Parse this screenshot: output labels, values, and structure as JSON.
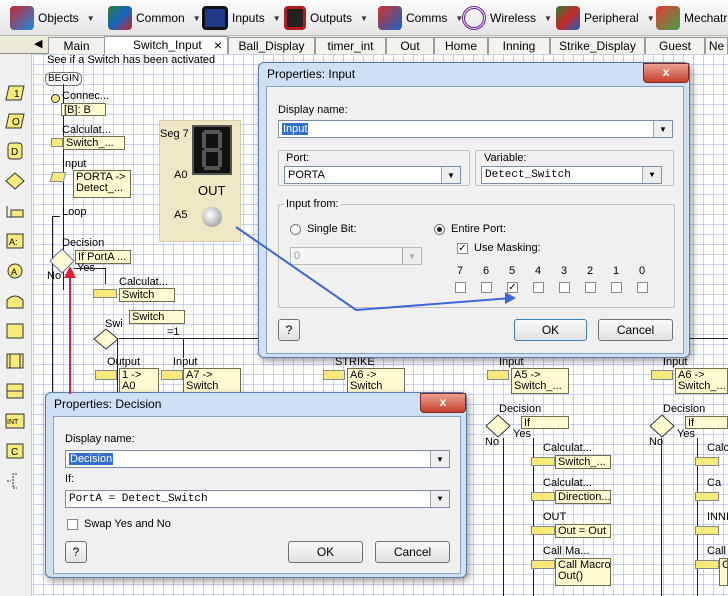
{
  "toolbar": {
    "items": [
      {
        "label": "Objects"
      },
      {
        "label": "Common"
      },
      {
        "label": "Inputs"
      },
      {
        "label": "Outputs"
      },
      {
        "label": "Comms"
      },
      {
        "label": "Wireless"
      },
      {
        "label": "Peripheral"
      },
      {
        "label": "Mechatr"
      }
    ]
  },
  "tabs": [
    "Main",
    "Switch_Input",
    "Ball_Display",
    "timer_int",
    "Out",
    "Home",
    "Inning",
    "Strike_Display",
    "Guest",
    "Ne"
  ],
  "tabs_close": "×",
  "canvas": {
    "comment": "See if a Switch has been activated",
    "begin": "BEGIN",
    "connection_label": "Connec...",
    "connection_box": "[B]: B",
    "calc1_label": "Calculat...",
    "calc1_box": "Switch_...",
    "input_label": "Input",
    "input_box": "PORTA ->\nDetect_...",
    "loop_label": "Loop",
    "decision_label": "Decision",
    "decision_box": "If PortA ...",
    "yes": "Yes",
    "no": "No",
    "calc2_label": "Calculat...",
    "calc2_box": "Switch =...",
    "switch_label": "Swi",
    "switch_box": "Switch S...",
    "switch_value": "=1",
    "output_label": "Output",
    "output_box": "1 -> A0",
    "input2_label": "Input",
    "input2_box": "A7 ->\nSwitch",
    "strike_label": "STRIKE",
    "strike_box": "A6 ->\nSwitch",
    "input3_label": "Input",
    "input3_box": "A5 ->\nSwitch_...",
    "input4_label": "Input",
    "input4_box": "A6 ->\nSwitch_...",
    "decision2_label": "Decision",
    "decision2_box": "If Switc...",
    "decision3_label": "Decision",
    "decision3_box": "If Switc...",
    "calc3_label": "Calculat...",
    "calc3_box": "Switch_...",
    "calc4_label": "Calculat...",
    "calc4_box": "Direction...",
    "out_label": "OUT",
    "out_box": "Out = Out",
    "callmacro_label": "Call Ma...",
    "callmacro_box": "Call Macro\nOut()",
    "calc5_label": "Calc",
    "calc6_label": "Ca",
    "inni_label": "INNI",
    "call_label": "Call",
    "right_box": "Ca",
    "seg_label": "Seg 7",
    "seg_pin": "A0",
    "seg_out": "OUT",
    "switch_pin": "A5"
  },
  "dialog_input": {
    "title": "Properties: Input",
    "close": "x",
    "display_name_label": "Display name:",
    "display_name_value": "Input",
    "port_label": "Port:",
    "port_value": "PORTA",
    "variable_label": "Variable:",
    "variable_value": "Detect_Switch",
    "input_from_label": "Input from:",
    "single_bit_label": "Single Bit:",
    "single_bit_value": "0",
    "entire_port_label": "Entire Port:",
    "use_masking_label": "Use Masking:",
    "bits": [
      "7",
      "6",
      "5",
      "4",
      "3",
      "2",
      "1",
      "0"
    ],
    "bit_checked": [
      false,
      false,
      true,
      false,
      false,
      false,
      false,
      false
    ],
    "help": "?",
    "ok": "OK",
    "cancel": "Cancel"
  },
  "dialog_decision": {
    "title": "Properties: Decision",
    "close": "x",
    "display_name_label": "Display name:",
    "display_name_value": "Decision",
    "if_label": "If:",
    "if_value": "PortA = Detect_Switch",
    "swap_label": "Swap Yes and No",
    "help": "?",
    "ok": "OK",
    "cancel": "Cancel"
  },
  "palette_icons": [
    "input-icon",
    "output-icon",
    "delay-icon",
    "decision-icon",
    "loop-icon",
    "connection-icon",
    "calculation-icon",
    "component-macro-icon",
    "macro-icon",
    "switch-icon",
    "interrupt-icon",
    "code-icon",
    "comment-icon"
  ],
  "colors": {
    "accent": "#3370c9",
    "dialog_frame": "#cfe0f5",
    "annotation_blue": "#3d66d8",
    "annotation_red": "#e0202e",
    "flow_box": "#fffbd0",
    "grid": "#96afeb"
  }
}
